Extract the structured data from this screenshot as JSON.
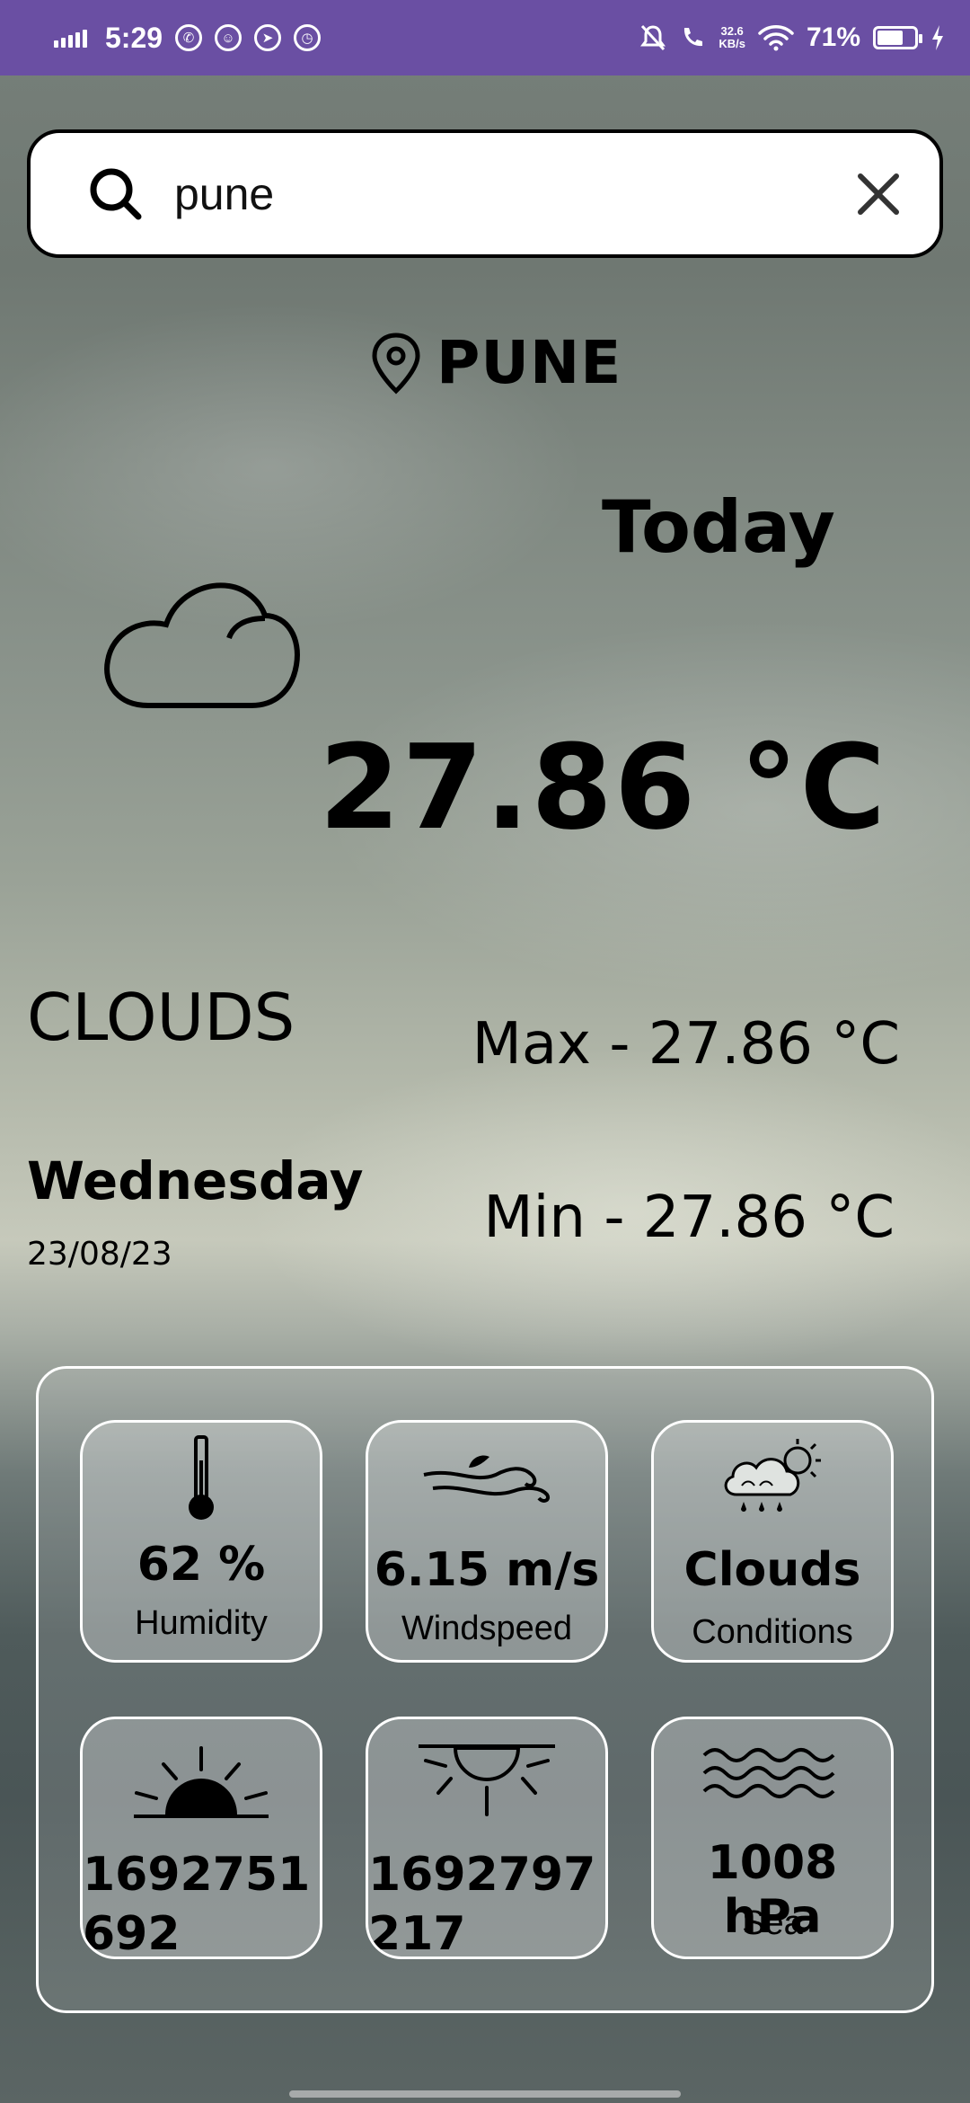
{
  "status_bar": {
    "time": "5:29",
    "net_speed": "32.6",
    "net_unit": "KB/s",
    "battery": "71%",
    "battery_level": 0.71
  },
  "search": {
    "value": "pune",
    "placeholder": ""
  },
  "location": {
    "city": "PUNE"
  },
  "today": {
    "heading": "Today",
    "temperature": "27.86 °C",
    "condition": "CLOUDS",
    "max": "Max - 27.86 °C",
    "min": "Min - 27.86 °C",
    "day": "Wednesday",
    "date": "23/08/23"
  },
  "details": [
    {
      "icon": "thermometer-icon",
      "value": "62 %",
      "label": "Humidity"
    },
    {
      "icon": "wind-icon",
      "value": "6.15 m/s",
      "label": "Windspeed"
    },
    {
      "icon": "cloud-sun-rain-icon",
      "value": "Clouds",
      "label": "Conditions"
    },
    {
      "icon": "sunrise-icon",
      "value": "1692751692",
      "label": ""
    },
    {
      "icon": "sunset-icon",
      "value": "1692797217",
      "label": ""
    },
    {
      "icon": "waves-icon",
      "value": "1008 hPa",
      "label": "Sea"
    }
  ]
}
